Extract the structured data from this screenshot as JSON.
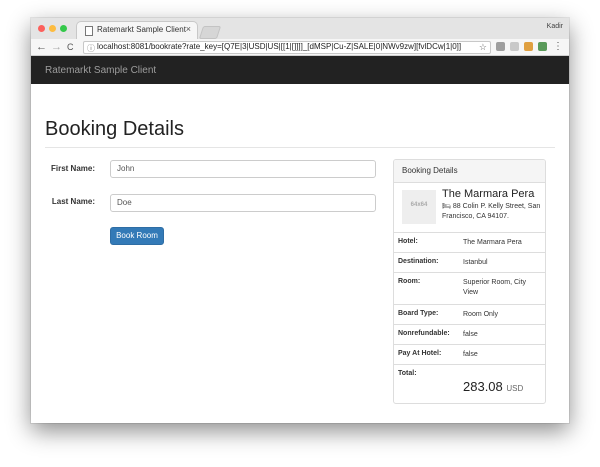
{
  "browser": {
    "tab_title": "Ratemarkt Sample Client",
    "tab_close": "×",
    "profile_name": "Kadir",
    "url": "localhost:8081/bookrate?rate_key=[Q7E|3|USD|US|[[1|[]]]]_[dMSP|Cu-Z|SALE|0|NWv9zw][fvlDCw|1|0]]",
    "back": "←",
    "forward": "→",
    "reload": "C",
    "info": "ⓘ",
    "star": "☆",
    "menu": "⋮"
  },
  "navbar": {
    "brand": "Ratemarkt Sample Client"
  },
  "page": {
    "title": "Booking Details"
  },
  "form": {
    "first_name_label": "First Name:",
    "first_name_value": "John",
    "last_name_label": "Last Name:",
    "last_name_value": "Doe",
    "submit_label": "Book Room"
  },
  "panel": {
    "heading": "Booking Details",
    "thumb_text": "64x64",
    "hotel_name": "The Marmara Pera",
    "bed_glyph": "🛏",
    "address": "88 Colin P. Kelly Street, San Francisco, CA 94107.",
    "rows": [
      {
        "label": "Hotel:",
        "value": "The Marmara Pera"
      },
      {
        "label": "Destination:",
        "value": "Istanbul"
      },
      {
        "label": "Room:",
        "value": "Superior Room, City View"
      },
      {
        "label": "Board Type:",
        "value": "Room Only"
      },
      {
        "label": "Nonrefundable:",
        "value": "false"
      },
      {
        "label": "Pay At Hotel:",
        "value": "false"
      }
    ],
    "total_label": "Total:",
    "total_amount": "283.08",
    "total_currency": "USD"
  },
  "colors": {
    "navbar_bg": "#222222",
    "button_primary": "#337ab7",
    "traffic_red": "#fc605c",
    "traffic_yellow": "#fdbc40",
    "traffic_green": "#34c84a"
  }
}
